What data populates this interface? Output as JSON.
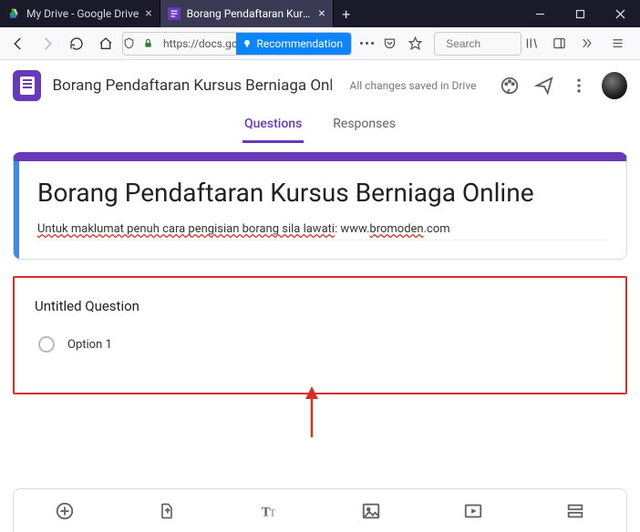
{
  "browser": {
    "tabs": [
      {
        "label": "My Drive - Google Drive",
        "favicon": "drive-icon"
      },
      {
        "label": "Borang Pendaftaran Kursus Be",
        "favicon": "forms-icon"
      }
    ],
    "url_display": "https://docs.go",
    "recommendation_label": "Recommendation",
    "search_placeholder": "Search"
  },
  "header": {
    "doc_title": "Borang Pendaftaran Kursus Berniaga Online",
    "save_status": "All changes saved in Drive"
  },
  "form_tabs": {
    "questions": "Questions",
    "responses": "Responses"
  },
  "title_card": {
    "title": "Borang Pendaftaran Kursus Berniaga Online",
    "desc_prefix": "Untuk maklumat penuh cara pengisian borang sila lawati",
    "desc_middle": ": www.",
    "desc_domain": "bromoden",
    "desc_suffix": ".com"
  },
  "question_card": {
    "title": "Untitled Question",
    "option1": "Option 1"
  },
  "colors": {
    "primary": "#673ab7",
    "annotation": "#d93025"
  }
}
